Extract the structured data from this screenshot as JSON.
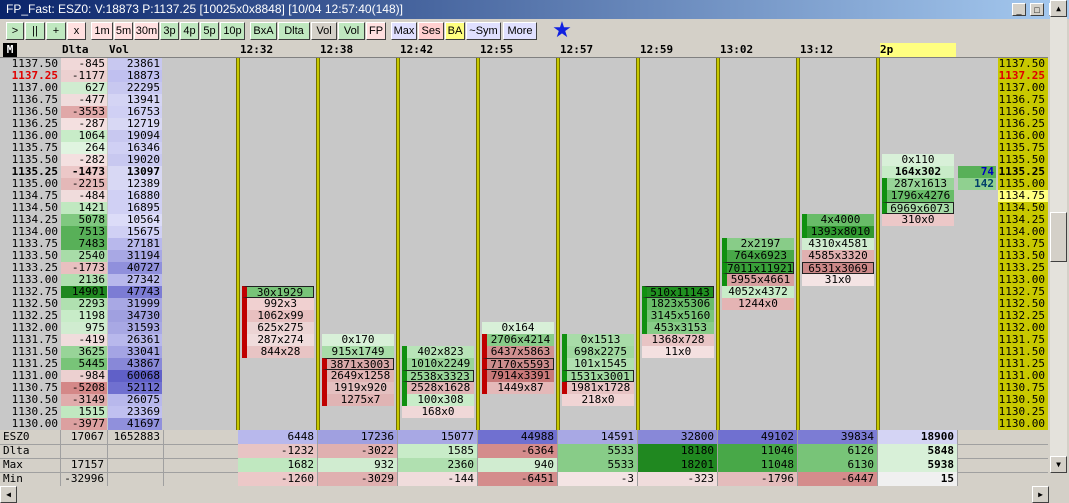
{
  "window": {
    "title": "FP_Fast: ESZ0: V:18873 P:1137.25 [10025x0x8848] [10/04 12:57:40(148)]",
    "controls": [
      "_",
      "□",
      "x"
    ]
  },
  "toolbar": {
    "buttons": [
      {
        "label": ">",
        "bg": "#c0e8c0"
      },
      {
        "label": "||",
        "bg": "#c0e8c0"
      },
      {
        "label": "+",
        "bg": "#c0e8c0"
      },
      {
        "label": "x",
        "bg": "#ffe0e0"
      },
      {
        "label": "1m",
        "bg": "#ffe0e0"
      },
      {
        "label": "5m",
        "bg": "#ffe0e0"
      },
      {
        "label": "30m",
        "bg": "#ffe0e0"
      },
      {
        "label": "3p",
        "bg": "#c0e8c0"
      },
      {
        "label": "4p",
        "bg": "#c0e8c0"
      },
      {
        "label": "5p",
        "bg": "#c0e8c0"
      },
      {
        "label": "10p",
        "bg": "#c0e8c0"
      },
      {
        "label": "BxA",
        "bg": "#c0e8c0"
      },
      {
        "label": "Dlta",
        "bg": "#c0e8c0"
      },
      {
        "label": "Vol",
        "bg": "#d4d0c8"
      },
      {
        "label": "Vol",
        "bg": "#c0e8c0"
      },
      {
        "label": "FP",
        "bg": "#ffe0e0"
      },
      {
        "label": "Max",
        "bg": "#e0e0ff"
      },
      {
        "label": "Ses",
        "bg": "#ffd0d0"
      },
      {
        "label": "BA",
        "bg": "#ffff80"
      },
      {
        "label": "~Sym",
        "bg": "#e0e0ff"
      },
      {
        "label": "More",
        "bg": "#e0e0ff"
      }
    ],
    "star_icon": "★"
  },
  "header": {
    "m_label": "M",
    "delta_label": "Dlta",
    "vol_label": "Vol",
    "times": [
      "12:32",
      "12:38",
      "12:42",
      "12:55",
      "12:57",
      "12:59",
      "13:02",
      "13:12",
      "2p"
    ]
  },
  "ladder": [
    {
      "price": "1137.50",
      "delta": "-845",
      "vol": "23861",
      "dc": "#f0d8d8",
      "vc": "#c8c8f0"
    },
    {
      "price": "1137.25",
      "delta": "-1177",
      "vol": "18873",
      "dc": "#ecd0d0",
      "vc": "#c0c0f0",
      "price_color": "#e00000"
    },
    {
      "price": "1137.00",
      "delta": "627",
      "vol": "22295",
      "dc": "#d0ecd0",
      "vc": "#c8c8f0"
    },
    {
      "price": "1136.75",
      "delta": "-477",
      "vol": "13941",
      "dc": "#f0dcdc",
      "vc": "#d4d4f4"
    },
    {
      "price": "1136.50",
      "delta": "-3553",
      "vol": "16753",
      "dc": "#e0a8a8",
      "vc": "#d0d0f4"
    },
    {
      "price": "1136.25",
      "delta": "-287",
      "vol": "12719",
      "dc": "#f4e0e0",
      "vc": "#d8d8f4"
    },
    {
      "price": "1136.00",
      "delta": "1064",
      "vol": "19094",
      "dc": "#c8ecc8",
      "vc": "#c8c8f0"
    },
    {
      "price": "1135.75",
      "delta": "264",
      "vol": "16346",
      "dc": "#e0f4e0",
      "vc": "#d0d0f4"
    },
    {
      "price": "1135.50",
      "delta": "-282",
      "vol": "19020",
      "dc": "#f4e0e0",
      "vc": "#c8c8f0"
    },
    {
      "price": "1135.25",
      "delta": "-1473",
      "vol": "13097",
      "dc": "#ecc8c8",
      "vc": "#d8d8f4",
      "bold": true
    },
    {
      "price": "1135.00",
      "delta": "-2215",
      "vol": "12389",
      "dc": "#e4b8b8",
      "vc": "#d8d8f4"
    },
    {
      "price": "1134.75",
      "delta": "-484",
      "vol": "16880",
      "dc": "#f0dcdc",
      "vc": "#d0d0f4"
    },
    {
      "price": "1134.50",
      "delta": "1421",
      "vol": "16895",
      "dc": "#c0e8c0",
      "vc": "#d0d0f4"
    },
    {
      "price": "1134.25",
      "delta": "5078",
      "vol": "10564",
      "dc": "#80c880",
      "vc": "#dcdcf8"
    },
    {
      "price": "1134.00",
      "delta": "7513",
      "vol": "15675",
      "dc": "#58b058",
      "vc": "#d0d0f4"
    },
    {
      "price": "1133.75",
      "delta": "7483",
      "vol": "27181",
      "dc": "#58b058",
      "vc": "#b8b8ec"
    },
    {
      "price": "1133.50",
      "delta": "2540",
      "vol": "31194",
      "dc": "#a8dca8",
      "vc": "#a8a8e4"
    },
    {
      "price": "1133.25",
      "delta": "-1773",
      "vol": "40727",
      "dc": "#e8c0c0",
      "vc": "#9090dc"
    },
    {
      "price": "1133.00",
      "delta": "2136",
      "vol": "27342",
      "dc": "#b0e0b0",
      "vc": "#b8b8ec"
    },
    {
      "price": "1132.75",
      "delta": "14901",
      "vol": "47743",
      "dc": "#208820",
      "vc": "#7c7cd4"
    },
    {
      "price": "1132.50",
      "delta": "2293",
      "vol": "31999",
      "dc": "#b0e0b0",
      "vc": "#a8a8e4"
    },
    {
      "price": "1132.25",
      "delta": "1198",
      "vol": "34730",
      "dc": "#c8ecc8",
      "vc": "#a0a0e0"
    },
    {
      "price": "1132.00",
      "delta": "975",
      "vol": "31593",
      "dc": "#d0ecd0",
      "vc": "#a8a8e4"
    },
    {
      "price": "1131.75",
      "delta": "-419",
      "vol": "26361",
      "dc": "#f0dcdc",
      "vc": "#b8b8ec"
    },
    {
      "price": "1131.50",
      "delta": "3625",
      "vol": "33041",
      "dc": "#98d498",
      "vc": "#a4a4e4"
    },
    {
      "price": "1131.25",
      "delta": "5445",
      "vol": "43867",
      "dc": "#78c478",
      "vc": "#8888d8"
    },
    {
      "price": "1131.00",
      "delta": "-984",
      "vol": "60068",
      "dc": "#ecd0d0",
      "vc": "#6060c8"
    },
    {
      "price": "1130.75",
      "delta": "-5208",
      "vol": "52112",
      "dc": "#d48888",
      "vc": "#7070d0"
    },
    {
      "price": "1130.50",
      "delta": "-3149",
      "vol": "26075",
      "dc": "#e0acac",
      "vc": "#b8b8ec"
    },
    {
      "price": "1130.25",
      "delta": "1515",
      "vol": "23369",
      "dc": "#c0e8c0",
      "vc": "#c0c0f0"
    },
    {
      "price": "1130.00",
      "delta": "-3977",
      "vol": "41697",
      "dc": "#dca0a0",
      "vc": "#9090dc"
    }
  ],
  "columns": [
    {
      "cells": [
        {
          "row": 19,
          "text": "30x1929",
          "bg": "#78c478",
          "mark": "#c00000",
          "box": true
        },
        {
          "row": 20,
          "text": "992x3",
          "bg": "#f0d0d0",
          "mark": "#c00000"
        },
        {
          "row": 21,
          "text": "1062x99",
          "bg": "#e8c0c0",
          "mark": "#c00000"
        },
        {
          "row": 22,
          "text": "625x275",
          "bg": "#ecd4d4",
          "mark": "#c00000"
        },
        {
          "row": 23,
          "text": "287x274",
          "bg": "#f0dcdc",
          "mark": "#c00000"
        },
        {
          "row": 24,
          "text": "844x28",
          "bg": "#e8c4c4",
          "mark": "#c00000"
        }
      ]
    },
    {
      "cells": [
        {
          "row": 23,
          "text": "0x170",
          "bg": "#d8f0d8"
        },
        {
          "row": 24,
          "text": "915x1749",
          "bg": "#a8dca8"
        },
        {
          "row": 25,
          "text": "3871x3003",
          "bg": "#d8a8a8",
          "mark": "#c00000",
          "box": true
        },
        {
          "row": 26,
          "text": "2649x1258",
          "bg": "#e0b4b4",
          "mark": "#c00000"
        },
        {
          "row": 27,
          "text": "1919x920",
          "bg": "#e4c0c0",
          "mark": "#c00000"
        },
        {
          "row": 28,
          "text": "1275x7",
          "bg": "#e0b4b4",
          "mark": "#c00000"
        }
      ]
    },
    {
      "cells": [
        {
          "row": 24,
          "text": "402x823",
          "bg": "#b8e4b8",
          "mark": "#109010"
        },
        {
          "row": 25,
          "text": "1010x2249",
          "bg": "#98d498",
          "mark": "#109010"
        },
        {
          "row": 26,
          "text": "2538x3323",
          "bg": "#98d498",
          "mark": "#109010",
          "box": true
        },
        {
          "row": 27,
          "text": "2528x1628",
          "bg": "#e0b4b4",
          "mark": "#109010"
        },
        {
          "row": 28,
          "text": "100x308",
          "bg": "#c8ecc8",
          "mark": "#109010"
        },
        {
          "row": 29,
          "text": "168x0",
          "bg": "#f0d8d8"
        }
      ]
    },
    {
      "cells": [
        {
          "row": 22,
          "text": "0x164",
          "bg": "#d8f0d8"
        },
        {
          "row": 23,
          "text": "2706x4214",
          "bg": "#88cc88",
          "mark": "#c00000"
        },
        {
          "row": 24,
          "text": "6437x5863",
          "bg": "#d09090",
          "mark": "#c00000"
        },
        {
          "row": 25,
          "text": "7170x5593",
          "bg": "#cc8c8c",
          "mark": "#c00000",
          "box": true
        },
        {
          "row": 26,
          "text": "7914x3391",
          "bg": "#c87878",
          "mark": "#c00000"
        },
        {
          "row": 27,
          "text": "1449x87",
          "bg": "#e4b8b8",
          "mark": "#c00000"
        }
      ]
    },
    {
      "cells": [
        {
          "row": 23,
          "text": "0x1513",
          "bg": "#a8dca8",
          "mark": "#109010"
        },
        {
          "row": 24,
          "text": "698x2275",
          "bg": "#a0d8a0",
          "mark": "#109010"
        },
        {
          "row": 25,
          "text": "101x1545",
          "bg": "#b0e0b0",
          "mark": "#109010"
        },
        {
          "row": 26,
          "text": "1531x3001",
          "bg": "#a0d8a0",
          "mark": "#109010",
          "box": true
        },
        {
          "row": 27,
          "text": "1981x1728",
          "bg": "#e8c4c4",
          "mark": "#c00000"
        },
        {
          "row": 28,
          "text": "218x0",
          "bg": "#f0d4d4"
        }
      ]
    },
    {
      "cells": [
        {
          "row": 19,
          "text": "510x11143",
          "bg": "#209020",
          "mark": "#109010",
          "box": true
        },
        {
          "row": 20,
          "text": "1823x5306",
          "bg": "#68bc68",
          "mark": "#109010"
        },
        {
          "row": 21,
          "text": "3145x5160",
          "bg": "#78c478",
          "mark": "#109010"
        },
        {
          "row": 22,
          "text": "453x3153",
          "bg": "#88cc88",
          "mark": "#109010"
        },
        {
          "row": 23,
          "text": "1368x728",
          "bg": "#e8c4c4"
        },
        {
          "row": 24,
          "text": "11x0",
          "bg": "#f4e0e0"
        }
      ]
    },
    {
      "cells": [
        {
          "row": 15,
          "text": "2x2197",
          "bg": "#88cc88",
          "mark": "#109010"
        },
        {
          "row": 16,
          "text": "764x6923",
          "bg": "#48a848",
          "mark": "#109010"
        },
        {
          "row": 17,
          "text": "7011x11921",
          "bg": "#38a038",
          "mark": "#109010",
          "box": true
        },
        {
          "row": 18,
          "text": "5955x4661",
          "bg": "#d8a0a0",
          "mark": "#109010"
        },
        {
          "row": 19,
          "text": "4052x4372",
          "bg": "#c8ecc8"
        },
        {
          "row": 20,
          "text": "1244x0",
          "bg": "#e4b4b4"
        }
      ]
    },
    {
      "cells": [
        {
          "row": 13,
          "text": "4x4000",
          "bg": "#68bc68",
          "mark": "#109010"
        },
        {
          "row": 14,
          "text": "1393x8010",
          "bg": "#309830",
          "mark": "#109010"
        },
        {
          "row": 15,
          "text": "4310x4581",
          "bg": "#d0ecd0"
        },
        {
          "row": 16,
          "text": "4585x3320",
          "bg": "#e0b0b0"
        },
        {
          "row": 17,
          "text": "6531x3069",
          "bg": "#cc8888",
          "box": true
        },
        {
          "row": 18,
          "text": "31x0",
          "bg": "#f4e4e4"
        }
      ]
    },
    {
      "cells": [
        {
          "row": 8,
          "text": "0x110",
          "bg": "#d8f0d8"
        },
        {
          "row": 9,
          "text": "164x302",
          "bg": "#c8ecc8",
          "bold": true
        },
        {
          "row": 10,
          "text": "287x1613",
          "bg": "#98d498",
          "mark": "#109010"
        },
        {
          "row": 11,
          "text": "1796x4276",
          "bg": "#68bc68",
          "mark": "#109010"
        },
        {
          "row": 12,
          "text": "6969x6073",
          "bg": "#a8dca8",
          "mark": "#109010",
          "box": true
        },
        {
          "row": 13,
          "text": "310x0",
          "bg": "#ecc8c8"
        }
      ]
    }
  ],
  "depth": [
    {
      "row": 9,
      "text": "74",
      "color": "#0000c0",
      "bg": "#58b058"
    },
    {
      "row": 10,
      "text": "142",
      "color": "#00406a",
      "bg": "#90d090"
    }
  ],
  "right_prices_highlight": {
    "row": 1,
    "color": "#e00000",
    "bg": "#c8c800",
    "bold": true
  },
  "right_prices_current": {
    "row": 11,
    "bg": "#ffff80"
  },
  "footer": {
    "labels": [
      "ESZ0",
      "Dlta",
      "Max",
      "Min"
    ],
    "session": [
      {
        "a": "17067",
        "b": "1652883"
      },
      {
        "a": "",
        "b": ""
      },
      {
        "a": "17157",
        "b": ""
      },
      {
        "a": "-32996",
        "b": ""
      }
    ],
    "values": [
      [
        "6448",
        "17236",
        "15077",
        "44988",
        "14591",
        "32800",
        "49102",
        "39834",
        "18900"
      ],
      [
        "-1232",
        "-3022",
        "1585",
        "-6364",
        "5533",
        "18180",
        "11046",
        "6126",
        "5848"
      ],
      [
        "1682",
        "932",
        "2360",
        "940",
        "5533",
        "18201",
        "11048",
        "6130",
        "5938"
      ],
      [
        "-1260",
        "-3029",
        "-144",
        "-6451",
        "-3",
        "-323",
        "-1796",
        "-6447",
        "15"
      ]
    ],
    "colors": [
      [
        "#b8b8ec",
        "#a0a0e0",
        "#a8a8e4",
        "#7070d0",
        "#a8a8e4",
        "#8888d8",
        "#7070d0",
        "#7c7cd4",
        "#d4d4f4"
      ],
      [
        "#e8c4c4",
        "#e0b0b0",
        "#c8ecc8",
        "#d48c8c",
        "#88cc88",
        "#208820",
        "#48a848",
        "#78c478",
        "#d8f0d8"
      ],
      [
        "#c0e8c0",
        "#d0ecd0",
        "#b0e0b0",
        "#d0ecd0",
        "#88cc88",
        "#208820",
        "#48a848",
        "#78c478",
        "#d8f0d8"
      ],
      [
        "#ecc8c8",
        "#e0b0b0",
        "#f0dcdc",
        "#d48c8c",
        "#f4e4e4",
        "#f0dcdc",
        "#e4bcbc",
        "#d48c8c",
        "#f0f0f0"
      ]
    ]
  }
}
